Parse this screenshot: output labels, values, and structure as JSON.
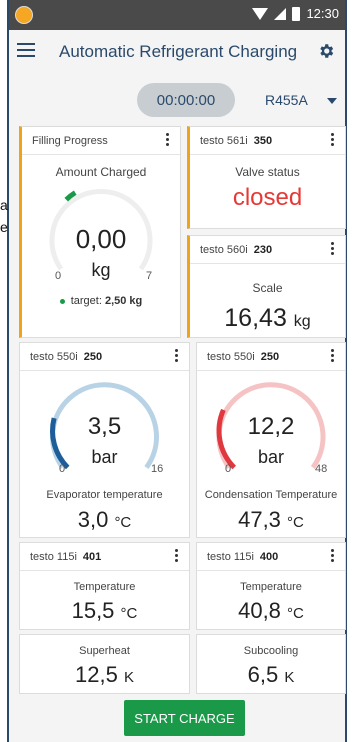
{
  "statusbar": {
    "time": "12:30"
  },
  "appbar": {
    "title": "Automatic Refrigerant Charging"
  },
  "peek": {
    "a": "a",
    "e": "e"
  },
  "session": {
    "timer": "00:00:00",
    "refrigerant": "R455A"
  },
  "filling": {
    "header": "Filling Progress",
    "label": "Amount Charged",
    "value": "0,00",
    "unit": "kg",
    "min": "0",
    "max": "7",
    "target_label": "target:",
    "target_value": "2,50 kg",
    "level_kg": 0,
    "target_kg": 2.5,
    "range_kg": [
      0,
      7
    ]
  },
  "valve": {
    "device": "testo 561i",
    "serial": "350",
    "label": "Valve status",
    "value": "closed"
  },
  "scale": {
    "device": "testo 560i",
    "serial": "230",
    "label": "Scale",
    "value": "16,43",
    "unit": "kg"
  },
  "evap": {
    "device": "testo 550i",
    "serial": "250",
    "pressure": "3,5",
    "unit": "bar",
    "min": "0",
    "max": "16",
    "level": 3.5,
    "range": [
      0,
      16
    ],
    "temp_label": "Evaporator temperature",
    "temp_value": "3,0",
    "temp_unit": "°C"
  },
  "cond": {
    "device": "testo 550i",
    "serial": "250",
    "pressure": "12,2",
    "unit": "bar",
    "min": "0",
    "max": "48",
    "level": 12.2,
    "range": [
      0,
      48
    ],
    "temp_label": "Condensation Temperature",
    "temp_value": "47,3",
    "temp_unit": "°C"
  },
  "t115a": {
    "device": "testo 115i",
    "serial": "401",
    "label": "Temperature",
    "value": "15,5",
    "unit": "°C"
  },
  "t115b": {
    "device": "testo 115i",
    "serial": "400",
    "label": "Temperature",
    "value": "40,8",
    "unit": "°C"
  },
  "superheat": {
    "label": "Superheat",
    "value": "12,5",
    "unit": "K"
  },
  "subcooling": {
    "label": "Subcooling",
    "value": "6,5",
    "unit": "K"
  },
  "actions": {
    "start": "START CHARGE"
  },
  "colors": {
    "accent": "#f0a21c",
    "primary": "#2b4a6b",
    "valve_closed": "#e53935",
    "go": "#1a9a49",
    "evap_arc": "#1d5d99",
    "evap_track": "#b9d3e6",
    "cond_arc": "#e0383f",
    "cond_track": "#f6c3c4"
  }
}
